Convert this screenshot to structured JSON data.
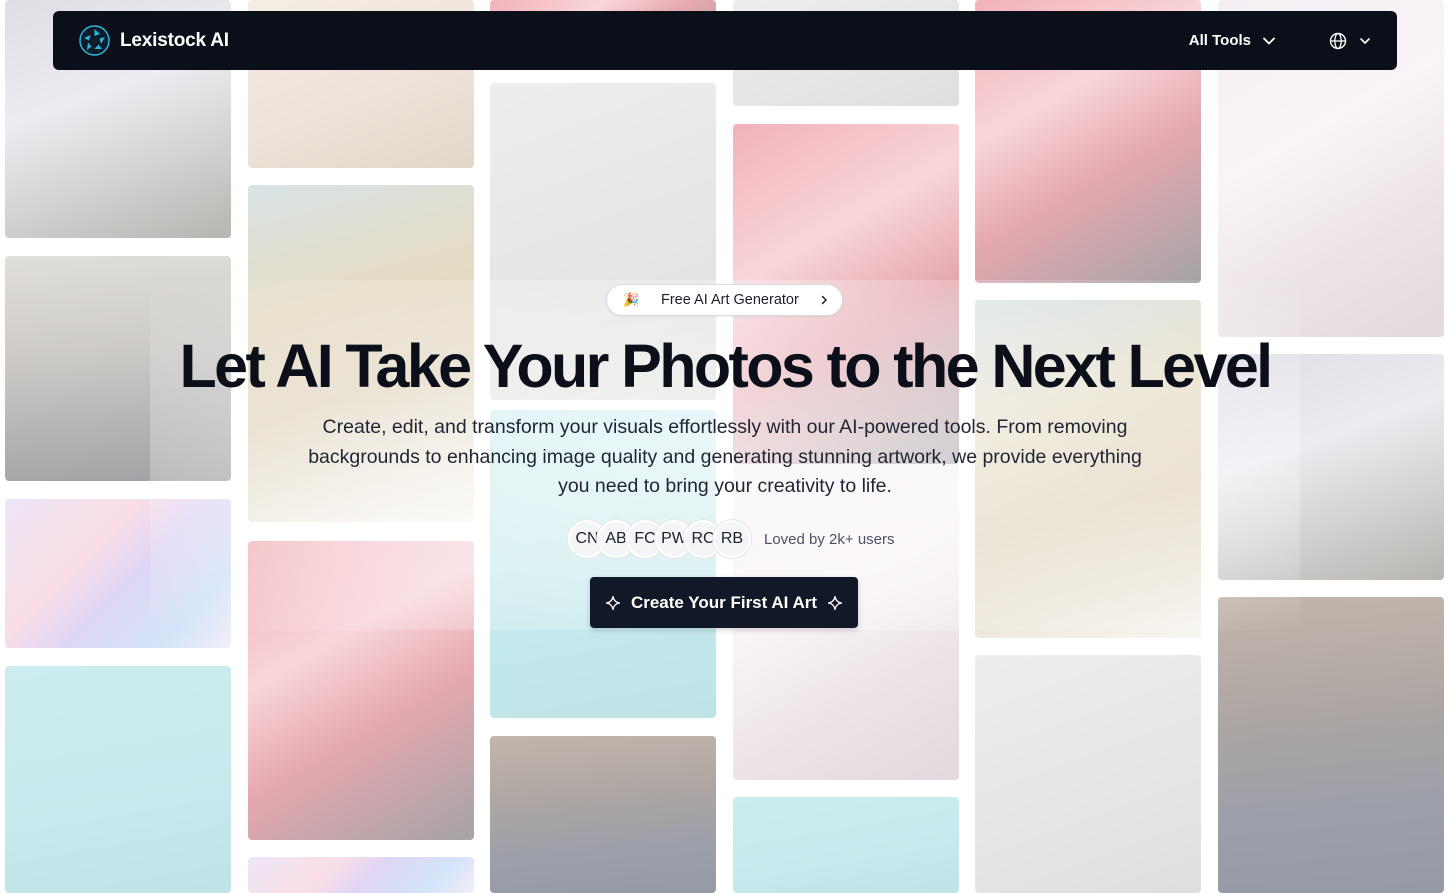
{
  "header": {
    "brand": "Lexistock AI",
    "all_tools_label": "All Tools",
    "icons": {
      "logo": "aperture-logo-icon",
      "tools_chevron": "chevron-down-icon",
      "language": "globe-icon",
      "language_chevron": "chevron-down-icon"
    }
  },
  "hero": {
    "badge": {
      "emoji": "🎉",
      "label": "Free AI Art Generator",
      "icon": "chevron-right-icon"
    },
    "headline": "Let AI Take Your Photos to the Next Level",
    "subtitle": "Create, edit, and transform your visuals effortlessly with our AI-powered tools. From removing backgrounds to enhancing image quality and generating stunning artwork, we provide everything you need to bring your creativity to life.",
    "avatars": [
      "CN",
      "AB",
      "FC",
      "PW",
      "RC",
      "RB"
    ],
    "loved_text": "Loved by 2k+ users",
    "cta": {
      "label": "Create Your First AI Art",
      "icon": "sparkle-icon"
    }
  },
  "colors": {
    "navbar_bg": "#0b0f19",
    "cta_bg": "#111827",
    "headline": "#0b0f19",
    "logo_accent": "#2bb5d8"
  }
}
